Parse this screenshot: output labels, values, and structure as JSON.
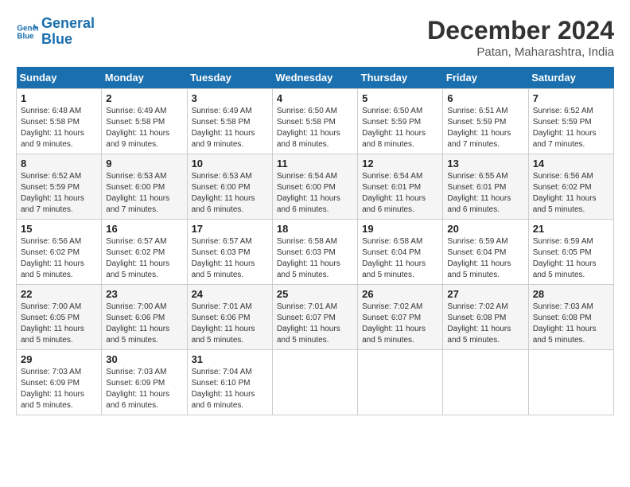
{
  "header": {
    "logo_line1": "General",
    "logo_line2": "Blue",
    "month_title": "December 2024",
    "location": "Patan, Maharashtra, India"
  },
  "days_of_week": [
    "Sunday",
    "Monday",
    "Tuesday",
    "Wednesday",
    "Thursday",
    "Friday",
    "Saturday"
  ],
  "weeks": [
    [
      {
        "day": "1",
        "sunrise": "6:48 AM",
        "sunset": "5:58 PM",
        "daylight": "11 hours and 9 minutes."
      },
      {
        "day": "2",
        "sunrise": "6:49 AM",
        "sunset": "5:58 PM",
        "daylight": "11 hours and 9 minutes."
      },
      {
        "day": "3",
        "sunrise": "6:49 AM",
        "sunset": "5:58 PM",
        "daylight": "11 hours and 9 minutes."
      },
      {
        "day": "4",
        "sunrise": "6:50 AM",
        "sunset": "5:58 PM",
        "daylight": "11 hours and 8 minutes."
      },
      {
        "day": "5",
        "sunrise": "6:50 AM",
        "sunset": "5:59 PM",
        "daylight": "11 hours and 8 minutes."
      },
      {
        "day": "6",
        "sunrise": "6:51 AM",
        "sunset": "5:59 PM",
        "daylight": "11 hours and 7 minutes."
      },
      {
        "day": "7",
        "sunrise": "6:52 AM",
        "sunset": "5:59 PM",
        "daylight": "11 hours and 7 minutes."
      }
    ],
    [
      {
        "day": "8",
        "sunrise": "6:52 AM",
        "sunset": "5:59 PM",
        "daylight": "11 hours and 7 minutes."
      },
      {
        "day": "9",
        "sunrise": "6:53 AM",
        "sunset": "6:00 PM",
        "daylight": "11 hours and 7 minutes."
      },
      {
        "day": "10",
        "sunrise": "6:53 AM",
        "sunset": "6:00 PM",
        "daylight": "11 hours and 6 minutes."
      },
      {
        "day": "11",
        "sunrise": "6:54 AM",
        "sunset": "6:00 PM",
        "daylight": "11 hours and 6 minutes."
      },
      {
        "day": "12",
        "sunrise": "6:54 AM",
        "sunset": "6:01 PM",
        "daylight": "11 hours and 6 minutes."
      },
      {
        "day": "13",
        "sunrise": "6:55 AM",
        "sunset": "6:01 PM",
        "daylight": "11 hours and 6 minutes."
      },
      {
        "day": "14",
        "sunrise": "6:56 AM",
        "sunset": "6:02 PM",
        "daylight": "11 hours and 5 minutes."
      }
    ],
    [
      {
        "day": "15",
        "sunrise": "6:56 AM",
        "sunset": "6:02 PM",
        "daylight": "11 hours and 5 minutes."
      },
      {
        "day": "16",
        "sunrise": "6:57 AM",
        "sunset": "6:02 PM",
        "daylight": "11 hours and 5 minutes."
      },
      {
        "day": "17",
        "sunrise": "6:57 AM",
        "sunset": "6:03 PM",
        "daylight": "11 hours and 5 minutes."
      },
      {
        "day": "18",
        "sunrise": "6:58 AM",
        "sunset": "6:03 PM",
        "daylight": "11 hours and 5 minutes."
      },
      {
        "day": "19",
        "sunrise": "6:58 AM",
        "sunset": "6:04 PM",
        "daylight": "11 hours and 5 minutes."
      },
      {
        "day": "20",
        "sunrise": "6:59 AM",
        "sunset": "6:04 PM",
        "daylight": "11 hours and 5 minutes."
      },
      {
        "day": "21",
        "sunrise": "6:59 AM",
        "sunset": "6:05 PM",
        "daylight": "11 hours and 5 minutes."
      }
    ],
    [
      {
        "day": "22",
        "sunrise": "7:00 AM",
        "sunset": "6:05 PM",
        "daylight": "11 hours and 5 minutes."
      },
      {
        "day": "23",
        "sunrise": "7:00 AM",
        "sunset": "6:06 PM",
        "daylight": "11 hours and 5 minutes."
      },
      {
        "day": "24",
        "sunrise": "7:01 AM",
        "sunset": "6:06 PM",
        "daylight": "11 hours and 5 minutes."
      },
      {
        "day": "25",
        "sunrise": "7:01 AM",
        "sunset": "6:07 PM",
        "daylight": "11 hours and 5 minutes."
      },
      {
        "day": "26",
        "sunrise": "7:02 AM",
        "sunset": "6:07 PM",
        "daylight": "11 hours and 5 minutes."
      },
      {
        "day": "27",
        "sunrise": "7:02 AM",
        "sunset": "6:08 PM",
        "daylight": "11 hours and 5 minutes."
      },
      {
        "day": "28",
        "sunrise": "7:03 AM",
        "sunset": "6:08 PM",
        "daylight": "11 hours and 5 minutes."
      }
    ],
    [
      {
        "day": "29",
        "sunrise": "7:03 AM",
        "sunset": "6:09 PM",
        "daylight": "11 hours and 5 minutes."
      },
      {
        "day": "30",
        "sunrise": "7:03 AM",
        "sunset": "6:09 PM",
        "daylight": "11 hours and 6 minutes."
      },
      {
        "day": "31",
        "sunrise": "7:04 AM",
        "sunset": "6:10 PM",
        "daylight": "11 hours and 6 minutes."
      },
      null,
      null,
      null,
      null
    ]
  ]
}
